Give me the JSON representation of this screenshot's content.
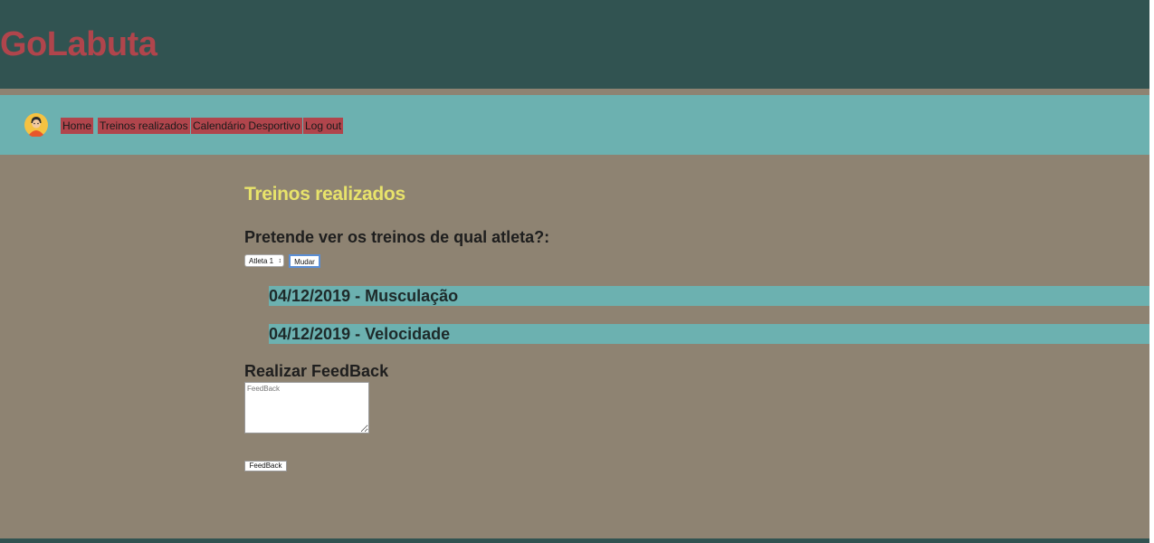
{
  "header": {
    "logo": "GoLabuta"
  },
  "nav": {
    "items": [
      {
        "label": "Home"
      },
      {
        "label": "Treinos realizados"
      },
      {
        "label": "Calendário Desportivo"
      },
      {
        "label": "Log out"
      }
    ]
  },
  "main": {
    "title": "Treinos realizados",
    "question": "Pretende ver os treinos de qual atleta?:",
    "athlete_select": {
      "value": "Atleta 1"
    },
    "change_button": "Mudar",
    "trainings": [
      {
        "label": "04/12/2019 - Musculação"
      },
      {
        "label": "04/12/2019 - Velocidade"
      }
    ],
    "feedback": {
      "title": "Realizar FeedBack",
      "placeholder": "FeedBack",
      "button": "FeedBack"
    }
  },
  "colors": {
    "header_bg": "#315351",
    "nav_bg": "#6cb1b0",
    "page_bg": "#8e8372",
    "accent_red": "#b0454c",
    "title_yellow": "#e8e36b"
  },
  "icons": {
    "avatar": "user-avatar-icon",
    "select_arrows": "updown-arrows-icon"
  }
}
